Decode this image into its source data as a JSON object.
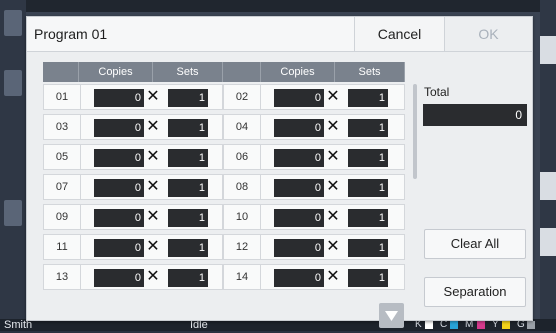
{
  "background": {
    "status_user": "Smith",
    "status_text": "Idle",
    "ink": [
      {
        "label": "K",
        "color": "#ffffff"
      },
      {
        "label": "C",
        "color": "#29a3d6"
      },
      {
        "label": "M",
        "color": "#d43a8c"
      },
      {
        "label": "Y",
        "color": "#f2d21a"
      },
      {
        "label": "G",
        "color": "#9aa0a8"
      }
    ]
  },
  "dialog": {
    "title": "Program 01",
    "cancel_label": "Cancel",
    "ok_label": "OK"
  },
  "table": {
    "headers": [
      "Copies",
      "Sets",
      "Copies",
      "Sets"
    ],
    "times_symbol": "✕",
    "rows": [
      {
        "left": {
          "no": "01",
          "copies": "0",
          "sets": "1"
        },
        "right": {
          "no": "02",
          "copies": "0",
          "sets": "1"
        }
      },
      {
        "left": {
          "no": "03",
          "copies": "0",
          "sets": "1"
        },
        "right": {
          "no": "04",
          "copies": "0",
          "sets": "1"
        }
      },
      {
        "left": {
          "no": "05",
          "copies": "0",
          "sets": "1"
        },
        "right": {
          "no": "06",
          "copies": "0",
          "sets": "1"
        }
      },
      {
        "left": {
          "no": "07",
          "copies": "0",
          "sets": "1"
        },
        "right": {
          "no": "08",
          "copies": "0",
          "sets": "1"
        }
      },
      {
        "left": {
          "no": "09",
          "copies": "0",
          "sets": "1"
        },
        "right": {
          "no": "10",
          "copies": "0",
          "sets": "1"
        }
      },
      {
        "left": {
          "no": "11",
          "copies": "0",
          "sets": "1"
        },
        "right": {
          "no": "12",
          "copies": "0",
          "sets": "1"
        }
      },
      {
        "left": {
          "no": "13",
          "copies": "0",
          "sets": "1"
        },
        "right": {
          "no": "14",
          "copies": "0",
          "sets": "1"
        }
      }
    ]
  },
  "side": {
    "total_label": "Total",
    "total_value": "0",
    "clear_all_label": "Clear All",
    "separation_label": "Separation"
  }
}
